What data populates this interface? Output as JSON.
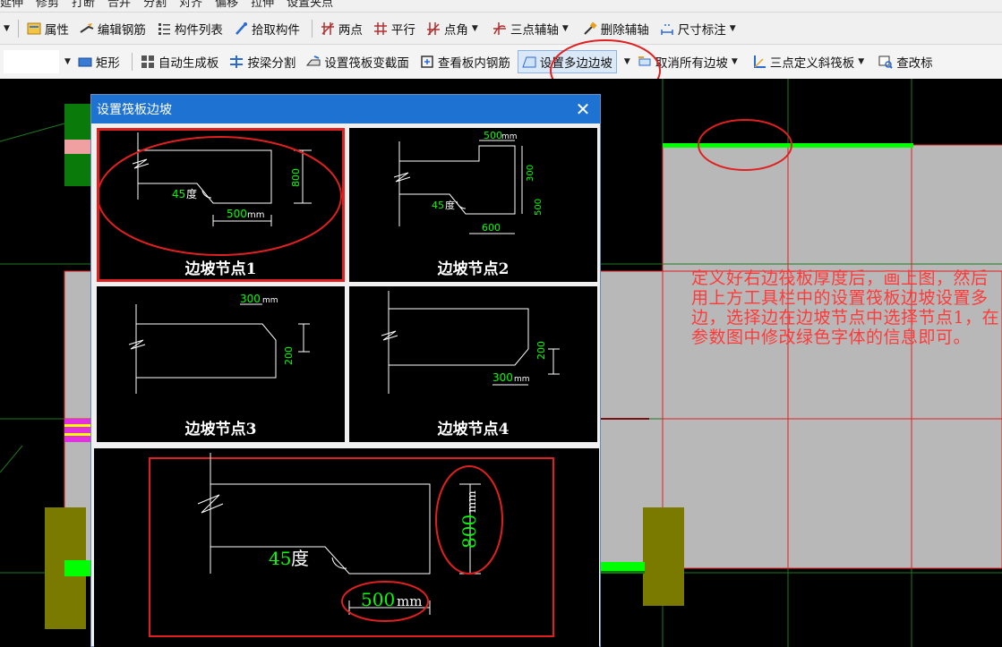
{
  "app": {
    "toolbar_top_partial": [
      "延伸",
      "修剪",
      "打断",
      "合并",
      "分割",
      "对齐",
      "偏移",
      "拉伸",
      "设置夹点"
    ],
    "toolbar_row1": [
      {
        "label": "属性",
        "icon": "properties-icon"
      },
      {
        "label": "编辑钢筋",
        "icon": "edit-rebar-icon"
      },
      {
        "label": "构件列表",
        "icon": "component-list-icon"
      },
      {
        "label": "拾取构件",
        "icon": "pick-component-icon"
      },
      {
        "label": "两点",
        "icon": "two-point-axis-icon"
      },
      {
        "label": "平行",
        "icon": "parallel-axis-icon"
      },
      {
        "label": "点角",
        "icon": "point-angle-icon"
      },
      {
        "label": "三点辅轴",
        "icon": "three-point-axis-icon"
      },
      {
        "label": "删除辅轴",
        "icon": "delete-axis-icon"
      },
      {
        "label": "尺寸标注",
        "icon": "dimension-icon"
      }
    ],
    "toolbar_row2": [
      {
        "label": "矩形",
        "icon": "rectangle-icon"
      },
      {
        "label": "自动生成板",
        "icon": "auto-slab-icon"
      },
      {
        "label": "按梁分割",
        "icon": "split-by-beam-icon"
      },
      {
        "label": "设置筏板变截面",
        "icon": "variable-section-icon"
      },
      {
        "label": "查看板内钢筋",
        "icon": "view-rebar-icon"
      },
      {
        "label": "设置多边边坡",
        "icon": "multi-edge-slope-icon"
      },
      {
        "label": "取消所有边坡",
        "icon": "cancel-slopes-icon"
      },
      {
        "label": "三点定义斜筏板",
        "icon": "three-point-slope-icon"
      },
      {
        "label": "查改标",
        "icon": "check-elevation-icon"
      }
    ]
  },
  "annotation": {
    "text": "定义好右边筏板厚度后，画上图，然后用上方工具栏中的设置筏板边坡设置多边，选择边在边坡节点中选择节点1，在参数图中修改绿色字体的信息即可。"
  },
  "dialog": {
    "title": "设置筏板边坡",
    "close_glyph": "✕",
    "nodes": [
      {
        "label": "边坡节点1",
        "angle": "45",
        "angle_unit": "度",
        "width": "500",
        "unit": "mm",
        "height": "800"
      },
      {
        "label": "边坡节点2",
        "top": "500",
        "bottom": "600",
        "angle": "45",
        "angle_unit": "度",
        "h1": "300",
        "h2": "500",
        "unit": "mm"
      },
      {
        "label": "边坡节点3",
        "width": "300",
        "height": "200",
        "unit": "mm"
      },
      {
        "label": "边坡节点4",
        "width": "300",
        "height": "200",
        "unit": "mm"
      }
    ],
    "preview": {
      "angle": "45",
      "angle_unit": "度",
      "width": "500",
      "height": "800",
      "unit": "mm"
    }
  },
  "colors": {
    "accent": "#1e72d2",
    "highlight_red": "#e02020",
    "param_green": "#00ff00",
    "slab_gray": "#b8b8b8"
  }
}
